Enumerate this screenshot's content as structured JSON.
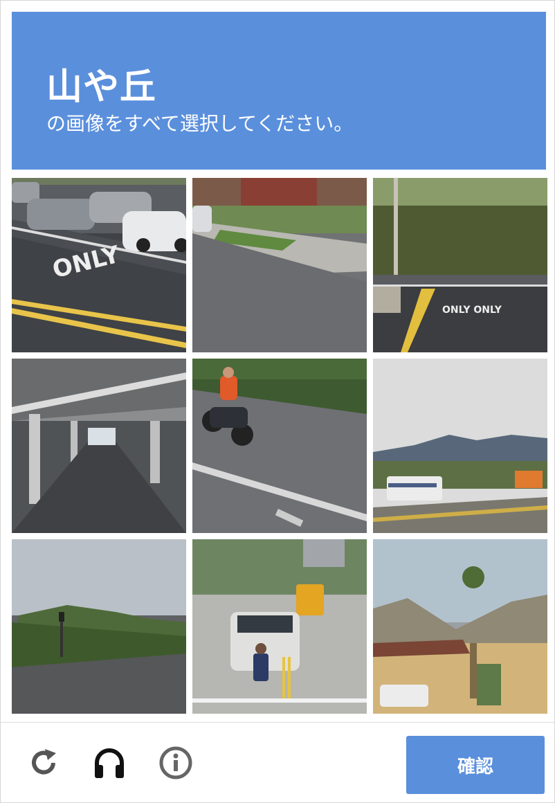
{
  "header": {
    "keyword": "山や丘",
    "instruction": "の画像をすべて選択してください。"
  },
  "tiles": [
    {
      "index": 0,
      "scene": "street with parked cars and ONLY road marking",
      "selected": false
    },
    {
      "index": 1,
      "scene": "sidewalk in front of brick building",
      "selected": false
    },
    {
      "index": 2,
      "scene": "intersection with ONLY ONLY road markings and trees",
      "selected": false
    },
    {
      "index": 3,
      "scene": "road under elevated railway",
      "selected": false
    },
    {
      "index": 4,
      "scene": "motorcycle rider on road",
      "selected": false
    },
    {
      "index": 5,
      "scene": "RV and truck on highway with mountains",
      "selected": false
    },
    {
      "index": 6,
      "scene": "road with traffic light and wooded hill",
      "selected": false
    },
    {
      "index": 7,
      "scene": "van, school bus and pedestrian at crosswalk",
      "selected": false
    },
    {
      "index": 8,
      "scene": "palm tree, house and rocky hill",
      "selected": false
    }
  ],
  "footer": {
    "reload_icon": "reload-icon",
    "audio_icon": "headphones-icon",
    "info_icon": "info-icon",
    "verify_label": "確認"
  },
  "colors": {
    "accent": "#5a8fdc",
    "icon": "#555555"
  }
}
